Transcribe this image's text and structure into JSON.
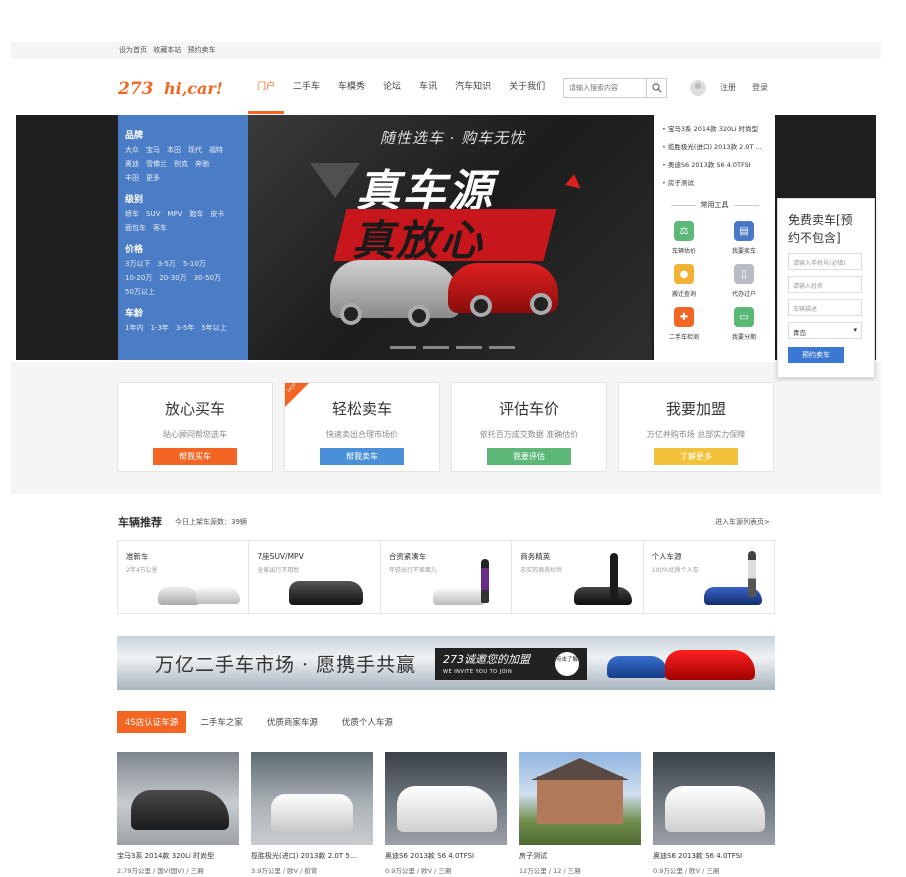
{
  "topbar": {
    "links": [
      "设为首页",
      "收藏本站",
      "预约卖车"
    ]
  },
  "header": {
    "logo_mark": "273",
    "logo_text": "hi,car!",
    "nav": [
      "门户",
      "二手车",
      "车模秀",
      "论坛",
      "车讯",
      "汽车知识",
      "关于我们"
    ],
    "search_placeholder": "请输入搜索内容",
    "register": "注册",
    "login": "登录"
  },
  "filter": {
    "brand": {
      "title": "品牌",
      "row1": [
        "大众",
        "宝马",
        "本田",
        "现代",
        "福特"
      ],
      "row2": [
        "奥迪",
        "雪佛兰",
        "别克",
        "奔驰"
      ],
      "row3": [
        "丰田",
        "更多"
      ]
    },
    "level": {
      "title": "级别",
      "row1": [
        "轿车",
        "SUV",
        "MPV",
        "跑车",
        "皮卡"
      ],
      "row2": [
        "面包车",
        "客车"
      ]
    },
    "price": {
      "title": "价格",
      "row1": [
        "3万以下",
        "3-5万",
        "5-10万"
      ],
      "row2": [
        "10-20万",
        "20-30万",
        "30-50万"
      ],
      "row3": [
        "50万以上"
      ]
    },
    "age": {
      "title": "车龄",
      "row1": [
        "1年内",
        "1-3年",
        "3-5年",
        "5年以上"
      ]
    }
  },
  "hero": {
    "slogan": "随性选车 · 购车无忧",
    "line1": "真车源",
    "line2": "真放心"
  },
  "news": [
    "宝马3系 2014款 320Li 时尚型",
    "揽胜极光(进口) 2013款 2.0T ...",
    "奥迪S6 2013款 S6 4.0TFSI",
    "房子测试"
  ],
  "tools": {
    "title": "常用工具",
    "items": [
      "车辆估价",
      "我要卖车",
      "搬迁查询",
      "代办过户",
      "二手车检测",
      "我要分期"
    ]
  },
  "sell_form": {
    "title": "免费卖车[预约不包含]",
    "phone_placeholder": "请输入手机号(必填)",
    "name_placeholder": "请输入姓名",
    "desc_placeholder": "车辆描述",
    "city": "青岛",
    "submit": "预约卖车"
  },
  "services": [
    {
      "title": "放心买车",
      "desc": "贴心顾问帮您选车",
      "button": "帮我买车",
      "color": "#f26522"
    },
    {
      "title": "轻松卖车",
      "desc": "快速卖出合理市场价",
      "button": "帮我卖车",
      "color": "#4a90d9",
      "badge": "HOT"
    },
    {
      "title": "评估车价",
      "desc": "依托百万成交数据  准确估价",
      "button": "我要评估",
      "color": "#5cb877"
    },
    {
      "title": "我要加盟",
      "desc": "万亿并购市场  总部实力保障",
      "button": "了解更多",
      "color": "#f2c33a"
    }
  ],
  "recommend": {
    "title": "车辆推荐",
    "subtitle": "今日上架车源数：39辆",
    "more": "进入车源列表页>",
    "cats": [
      {
        "name": "准新车",
        "sub": "2年4万公里"
      },
      {
        "name": "7座SUV/MPV",
        "sub": "全家出行不用愁"
      },
      {
        "name": "合资紧凑车",
        "sub": "年轻出行不差面儿"
      },
      {
        "name": "商务精英",
        "sub": "忠实的商务伙伴"
      },
      {
        "name": "个人车源",
        "sub": "100%优质个人车"
      }
    ]
  },
  "banner": {
    "text": "万亿二手车市场 · 愿携手共赢",
    "join": "273诚邀您的加盟",
    "join_en": "WE INVITE YOU TO JOIN",
    "click": "点击了解"
  },
  "tabs": [
    "4S店认证车源",
    "二手车之家",
    "优质商家车源",
    "优质个人车源"
  ],
  "listings": [
    {
      "name": "宝马3系 2014款 320Li 时尚型",
      "meta": "2.79万公里 / 国V(国V) / 三厢"
    },
    {
      "name": "揽胜极光(进口) 2013款 2.0T 5...",
      "meta": "3.9万公里 / 欧V / 掀背"
    },
    {
      "name": "奥迪S6 2013款 S6 4.0TFSI",
      "meta": "0.9万公里 / 欧V / 三厢"
    },
    {
      "name": "房子测试",
      "meta": "12万公里 / 12 / 三厢"
    },
    {
      "name": "奥迪S6 2013款 S6 4.0TFSI",
      "meta": "0.9万公里 / 欧V / 三厢"
    }
  ]
}
